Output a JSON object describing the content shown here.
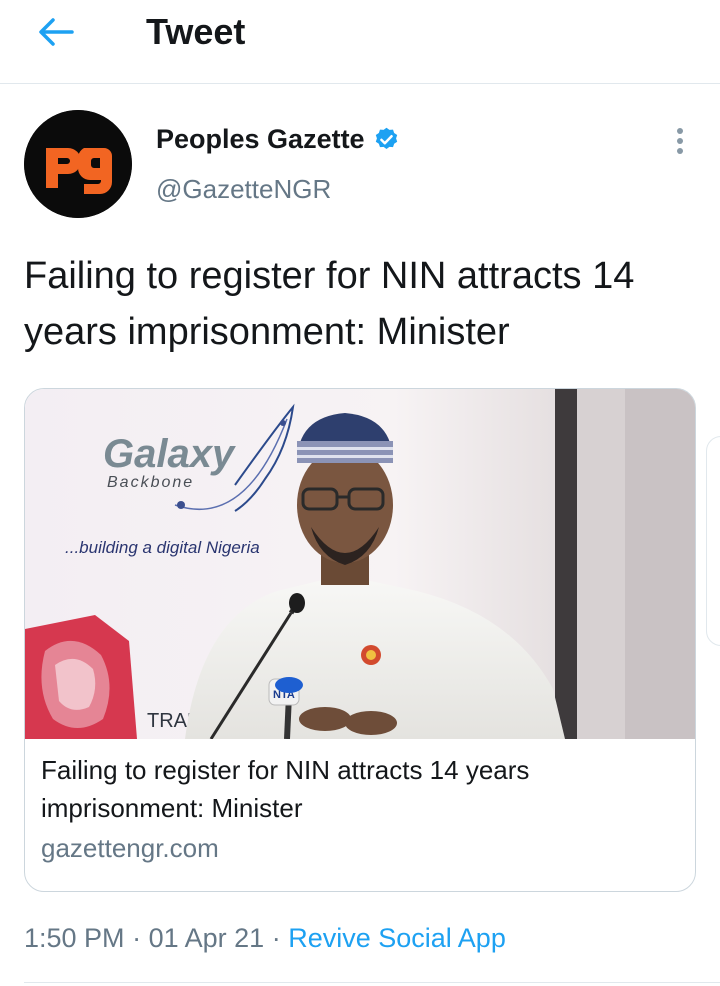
{
  "header": {
    "title": "Tweet",
    "back_icon": "arrow-left-icon"
  },
  "author": {
    "name": "Peoples Gazette",
    "handle": "@GazetteNGR",
    "verified": true,
    "avatar_text": "pg"
  },
  "tweet": {
    "text": "Failing to register for NIN attracts 14 years imprisonment: Minister",
    "time": "1:50 PM",
    "date": "01 Apr 21",
    "separator": "·",
    "source": "Revive Social App"
  },
  "card": {
    "title": "Failing to register for NIN attracts 14 years imprisonment: Minister",
    "domain": "gazettengr.com",
    "image": {
      "banner_brand": "Galaxy",
      "banner_sub": "Backbone",
      "banner_tagline": "...building a digital Nigeria",
      "banner_partial": "TRANS",
      "mic_label": "NTA"
    }
  },
  "colors": {
    "accent": "#1da1f2",
    "secondary_text": "#657786",
    "border": "#e1e8ed",
    "avatar_bg": "#0b0b0b",
    "avatar_logo": "#f26522"
  }
}
